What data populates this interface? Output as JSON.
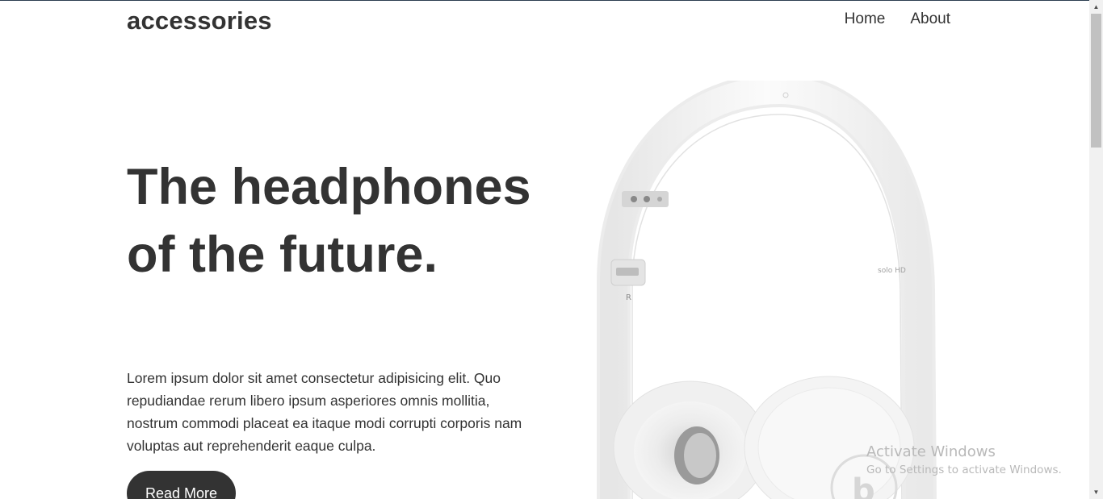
{
  "header": {
    "logo": "accessories",
    "nav": [
      {
        "label": "Home"
      },
      {
        "label": "About"
      }
    ]
  },
  "hero": {
    "headline": "The headphones of the future.",
    "body": "Lorem ipsum dolor sit amet consectetur adipisicing elit. Quo repudiandae rerum libero ipsum asperiores omnis mollitia, nostrum commodi placeat ea itaque modi corrupti corporis nam voluptas aut reprehenderit eaque culpa.",
    "button_label": "Read More",
    "image": {
      "icon": "white-headphones-image",
      "side_label": "R",
      "model_label": "solo HD"
    }
  },
  "overlay": {
    "watermark_title": "Activate Windows",
    "watermark_subtitle": "Go to Settings to activate Windows."
  },
  "colors": {
    "text": "#333333",
    "button_bg": "#333333",
    "button_text": "#ffffff",
    "background": "#ffffff",
    "scrollbar_track": "#f1f1f1",
    "scrollbar_thumb": "#c1c1c1"
  }
}
